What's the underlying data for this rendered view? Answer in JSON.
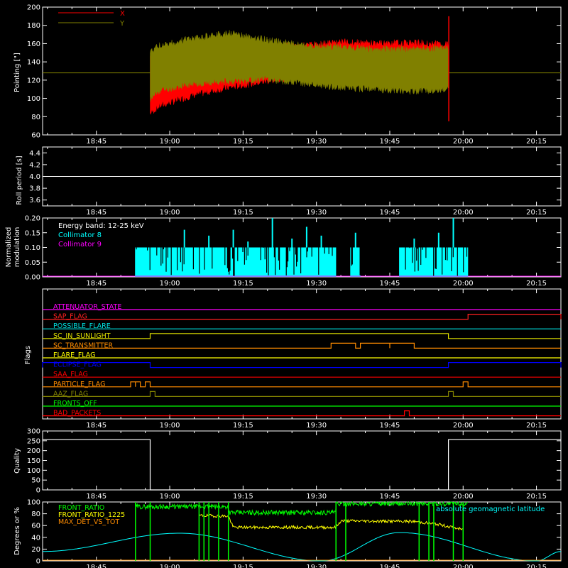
{
  "colors": {
    "background": "#000000",
    "axes": "#ffffff",
    "x_series": "#ff0000",
    "y_series": "#808000",
    "collimator8": "#00ffff",
    "collimator9": "#ff00ff",
    "front_ratio": "#00ff00",
    "front_ratio_1225": "#ffff00",
    "max_det_vs_tot": "#ff8c00",
    "geomag_lat": "#00ffff"
  },
  "time_axis": {
    "start": "18:34",
    "end": "20:20",
    "start_min": 1114,
    "end_min": 1220,
    "ticks": [
      "18:45",
      "19:00",
      "19:15",
      "19:30",
      "19:45",
      "20:00",
      "20:15"
    ],
    "tick_min": [
      1125,
      1140,
      1155,
      1170,
      1185,
      1200,
      1215
    ]
  },
  "chart_data": [
    {
      "type": "line",
      "panel": "pointing",
      "ylabel": "Pointing [\"]",
      "ylim": [
        60,
        200
      ],
      "yticks": [
        60,
        80,
        100,
        120,
        140,
        160,
        180,
        200
      ],
      "legend_position": "top-left",
      "series": [
        {
          "name": "X",
          "color": "#ff0000",
          "t": [
            "18:56",
            "18:58",
            "19:05",
            "19:12",
            "19:20",
            "19:28",
            "19:35",
            "19:42",
            "19:50",
            "19:57"
          ],
          "upper": [
            150,
            152,
            160,
            166,
            160,
            162,
            166,
            164,
            165,
            163
          ],
          "lower": [
            80,
            88,
            100,
            108,
            115,
            122,
            128,
            124,
            122,
            120
          ]
        },
        {
          "name": "Y",
          "color": "#808000",
          "t": [
            "18:56",
            "18:58",
            "19:05",
            "19:12",
            "19:20",
            "19:28",
            "19:35",
            "19:42",
            "19:50",
            "19:57"
          ],
          "upper": [
            155,
            162,
            170,
            175,
            168,
            162,
            160,
            158,
            158,
            160
          ],
          "lower": [
            95,
            105,
            112,
            115,
            117,
            112,
            108,
            106,
            104,
            106
          ]
        }
      ],
      "baseline_value": 128
    },
    {
      "type": "line",
      "panel": "roll_period",
      "ylabel": "Roll period [s]",
      "ylim": [
        3.5,
        4.5
      ],
      "yticks": [
        "3.6",
        "3.8",
        "4.0",
        "4.2",
        "4.4"
      ],
      "series": [
        {
          "name": "",
          "color": "#ffffff",
          "value": 4.0
        }
      ]
    },
    {
      "type": "line",
      "panel": "modulation",
      "ylabel": "Normalized modulation",
      "ylabel_lines": [
        "Normalized",
        "modulation"
      ],
      "ylim": [
        0,
        0.2
      ],
      "yticks": [
        "0.00",
        "0.05",
        "0.10",
        "0.15",
        "0.20"
      ],
      "legend": [
        "Energy band: 12-25 keV",
        "Collimator 8",
        "Collimator 9"
      ],
      "series": [
        {
          "name": "Collimator 8",
          "color": "#00ffff",
          "level": 0.1,
          "segments": [
            [
              "18:53",
              "19:34"
            ],
            [
              "19:37",
              "19:39"
            ],
            [
              "19:47",
              "20:01"
            ]
          ],
          "spikes": [
            [
              "19:03",
              0.16
            ],
            [
              "19:08",
              0.14
            ],
            [
              "19:13",
              0.16
            ],
            [
              "19:16",
              0.12
            ],
            [
              "19:21",
              0.2
            ],
            [
              "19:25",
              0.13
            ],
            [
              "19:28",
              0.17
            ],
            [
              "19:31",
              0.14
            ],
            [
              "19:38",
              0.15
            ],
            [
              "19:50",
              0.13
            ],
            [
              "19:55",
              0.15
            ],
            [
              "19:58",
              0.2
            ]
          ]
        },
        {
          "name": "Collimator 9",
          "color": "#ff00ff",
          "value": 0
        }
      ]
    },
    {
      "type": "line",
      "panel": "flags",
      "ylabel": "Flags",
      "flags": [
        {
          "name": "ATTENUATOR_STATE",
          "color": "#ff00ff",
          "steps": []
        },
        {
          "name": "SAP_FLAG",
          "color": "#ff2020",
          "steps": [
            [
              "20:01",
              "20:20"
            ]
          ]
        },
        {
          "name": "POSSIBLE_FLARE",
          "color": "#00e0e0",
          "steps": []
        },
        {
          "name": "SC_IN_SUNLIGHT",
          "color": "#e0e000",
          "steps": [
            [
              "18:56",
              "19:57"
            ]
          ]
        },
        {
          "name": "SC_TRANSMITTER",
          "color": "#ff8c00",
          "steps": [
            [
              "19:33",
              "19:38"
            ],
            [
              "19:39",
              "19:45"
            ],
            [
              "19:45",
              "19:50"
            ]
          ]
        },
        {
          "name": "FLARE_FLAG",
          "color": "#ffff00",
          "steps": []
        },
        {
          "name": "ECLIPSE_FLAG",
          "color": "#0000ff",
          "steps": [
            [
              "18:34",
              "18:56"
            ],
            [
              "19:57",
              "20:20"
            ]
          ]
        },
        {
          "name": "SAA_FLAG",
          "color": "#ff0000",
          "steps": []
        },
        {
          "name": "PARTICLE_FLAG",
          "color": "#ff8c00",
          "steps": [
            [
              "18:52",
              "18:53"
            ],
            [
              "18:53",
              "18:54"
            ],
            [
              "18:55",
              "18:56"
            ],
            [
              "20:00",
              "20:01"
            ]
          ]
        },
        {
          "name": "AAZ_FLAG",
          "color": "#808000",
          "steps": [
            [
              "18:56",
              "18:57"
            ],
            [
              "19:57",
              "19:58"
            ]
          ]
        },
        {
          "name": "FRONTS_OFF",
          "color": "#00ff00",
          "steps": []
        },
        {
          "name": "BAD_PACKETS",
          "color": "#ff0000",
          "steps": [
            [
              "19:48",
              "19:49"
            ]
          ]
        }
      ]
    },
    {
      "type": "line",
      "panel": "quality",
      "ylabel": "Quality",
      "ylim": [
        0,
        300
      ],
      "yticks": [
        "0",
        "50",
        "100",
        "150",
        "200",
        "250",
        "300"
      ],
      "series": [
        {
          "name": "",
          "color": "#ffffff",
          "points": [
            [
              "18:34",
              256
            ],
            [
              "18:56",
              256
            ],
            [
              "18:56",
              0
            ],
            [
              "19:57",
              0
            ],
            [
              "19:57",
              256
            ],
            [
              "20:20",
              256
            ]
          ]
        }
      ]
    },
    {
      "type": "line",
      "panel": "ratios",
      "ylabel": "Degrees or %",
      "ylim": [
        0,
        100
      ],
      "yticks": [
        "0",
        "20",
        "40",
        "60",
        "80",
        "100"
      ],
      "legend": [
        "FRONT_RATIO",
        "FRONT_RATIO_1225",
        "MAX_DET_VS_TOT"
      ],
      "annotation": "absolute geomagnetic latitude",
      "series": [
        {
          "name": "FRONT_RATIO",
          "color": "#00ff00",
          "level_early": 92,
          "level_late": 97,
          "segments": [
            [
              "18:53",
              "20:01"
            ]
          ],
          "dropouts": [
            "18:53",
            "18:56",
            "19:06",
            "19:07",
            "19:08",
            "19:10",
            "19:12",
            "19:34",
            "19:36",
            "19:51",
            "19:53",
            "19:54",
            "19:58",
            "20:00"
          ]
        },
        {
          "name": "FRONT_RATIO_1225",
          "color": "#ffff00",
          "t": [
            "19:06",
            "19:12",
            "19:13",
            "19:34",
            "19:35",
            "19:50",
            "19:55",
            "20:00"
          ],
          "v": [
            77,
            76,
            57,
            57,
            68,
            67,
            62,
            53
          ]
        },
        {
          "name": "MAX_DET_VS_TOT",
          "color": "#ff8c00",
          "value": 0
        },
        {
          "name": "absolute geomagnetic latitude",
          "color": "#00ffff",
          "t": [
            "18:34",
            "19:02",
            "19:31",
            "19:47",
            "20:15",
            "20:20"
          ],
          "v": [
            16,
            47,
            0,
            48,
            0,
            16
          ]
        }
      ]
    }
  ]
}
